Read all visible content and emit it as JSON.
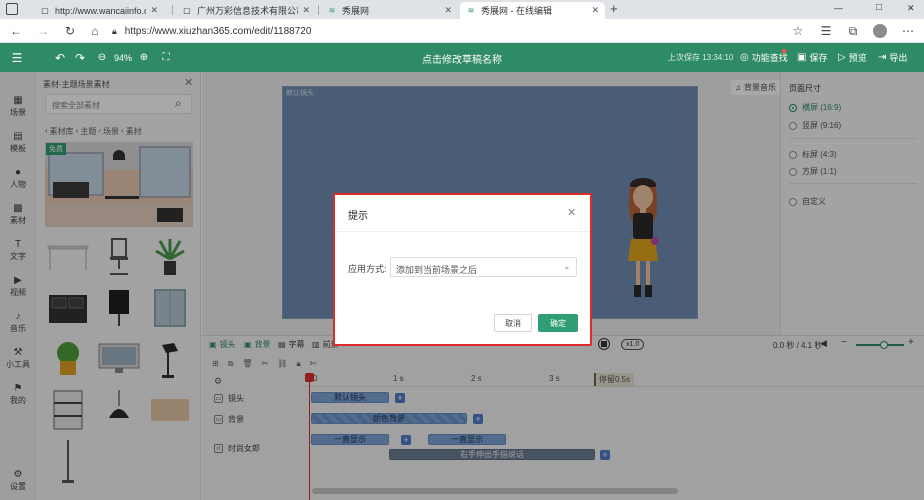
{
  "browser": {
    "tabs": [
      {
        "label": "http://www.wancaiinfo.com/ - 图",
        "icon": "page-icon",
        "active": false
      },
      {
        "label": "广州万彩信息技术有限公司",
        "icon": "page-icon",
        "active": false
      },
      {
        "label": "秀展网",
        "icon": "xiuzhan-logo-icon",
        "active": false
      },
      {
        "label": "秀展网 - 在线编辑",
        "icon": "xiuzhan-logo-icon",
        "active": true
      }
    ],
    "url": "https://www.xiuzhan365.com/edit/1188720",
    "window_controls": [
      "—",
      "□",
      "✕"
    ]
  },
  "header": {
    "title": "点击修改草稿名称",
    "zoom": "94%",
    "last_save": "上次保存 13:34:10",
    "buttons": {
      "check": "功能查找",
      "save": "保存",
      "preview": "预览",
      "export": "导出"
    }
  },
  "sidebar": {
    "items": [
      {
        "label": "场景",
        "icon": "scene-icon"
      },
      {
        "label": "模板",
        "icon": "template-icon"
      },
      {
        "label": "人物",
        "icon": "person-icon"
      },
      {
        "label": "素材",
        "icon": "material-icon"
      },
      {
        "label": "文字",
        "icon": "text-icon"
      },
      {
        "label": "视频",
        "icon": "video-icon"
      },
      {
        "label": "音乐",
        "icon": "music-icon"
      },
      {
        "label": "小工具",
        "icon": "tools-icon"
      },
      {
        "label": "我的",
        "icon": "my-icon"
      }
    ],
    "settings_label": "设置"
  },
  "material_panel": {
    "title": "素材-主题场景素材",
    "search_placeholder": "搜索全部素材",
    "breadcrumb": [
      "素材库",
      "主题",
      "场景",
      "素材"
    ],
    "badge": "免费"
  },
  "canvas": {
    "lens_label": "默认镜头",
    "bg_music": "背景音乐"
  },
  "right_panel": {
    "title": "页面尺寸",
    "options": [
      {
        "label": "横屏 (16:9)",
        "selected": true
      },
      {
        "label": "竖屏 (9:16)",
        "selected": false
      },
      {
        "label": "标屏 (4:3)",
        "selected": false
      },
      {
        "label": "方屏 (1:1)",
        "selected": false
      },
      {
        "label": "自定义",
        "selected": false
      }
    ]
  },
  "timeline": {
    "tabs": [
      "镜头",
      "背景",
      "字幕",
      "前景"
    ],
    "speed": "x1.0",
    "time_display": "0.0 秒 / 4.1 秒",
    "ticks": [
      "0",
      "1 s",
      "2 s",
      "3 s"
    ],
    "pause_label": "停留0.5s",
    "tracks": [
      "镜头",
      "背景",
      "时尚女郎"
    ],
    "clips": {
      "lens": "默认镜头",
      "background": "颜色背景",
      "show1": "一直显示",
      "show2": "一直显示",
      "action": "右手伸出手指说话"
    }
  },
  "dialog": {
    "title": "提示",
    "field_label": "应用方式:",
    "select_value": "添加到当前场景之后",
    "cancel": "取消",
    "confirm": "确定"
  },
  "colors": {
    "brand_green": "#2f8b66",
    "highlight_red": "#e12b2b",
    "clip_blue": "#7fa3d6"
  }
}
